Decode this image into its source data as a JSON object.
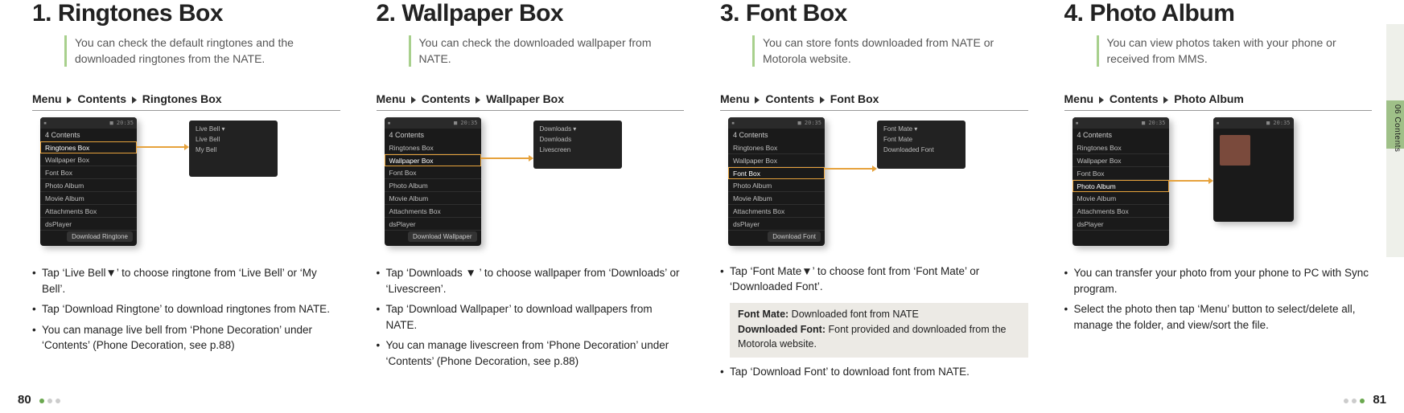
{
  "side_tab": "06 Contents",
  "page_left": "80",
  "page_right": "81",
  "sections": [
    {
      "title": "1. Ringtones Box",
      "intro": "You can check the default ringtones and the downloaded ringtones from the NATE.",
      "crumb": [
        "Menu",
        "Contents",
        "Ringtones Box"
      ],
      "phone": {
        "header": "4 Contents",
        "items": [
          "Ringtones Box",
          "Wallpaper Box",
          "Font Box",
          "Photo Album",
          "Movie Album",
          "Attachments Box",
          "dsPlayer"
        ],
        "highlight_index": 0,
        "footer_btn": "Download Ringtone",
        "sub_items": [
          "Live Bell ▾",
          "Live Bell",
          "My Bell"
        ]
      },
      "bullets": [
        "Tap ‘Live Bell▼’ to choose ringtone from ‘Live Bell’ or ‘My Bell’.",
        "Tap ‘Download Ringtone’ to download ringtones from NATE.",
        "You can manage live bell from ‘Phone Decoration’ under ‘Contents’ (Phone Decoration, see p.88)"
      ]
    },
    {
      "title": "2. Wallpaper Box",
      "intro": "You can check the downloaded wallpaper from NATE.",
      "crumb": [
        "Menu",
        "Contents",
        "Wallpaper Box"
      ],
      "phone": {
        "header": "4 Contents",
        "items": [
          "Ringtones Box",
          "Wallpaper Box",
          "Font Box",
          "Photo Album",
          "Movie Album",
          "Attachments Box",
          "dsPlayer"
        ],
        "highlight_index": 1,
        "footer_btn": "Download Wallpaper",
        "sub_items": [
          "Downloads ▾",
          "Downloads",
          "Livescreen"
        ]
      },
      "bullets": [
        "Tap ‘Downloads ▼ ’ to choose wallpaper from ‘Downloads’ or ‘Livescreen’.",
        "Tap ‘Download Wallpaper’ to download wallpapers from NATE.",
        "You can manage livescreen from ‘Phone Decoration’ under ‘Contents’ (Phone Decoration, see p.88)"
      ]
    },
    {
      "title": "3. Font Box",
      "intro": "You can store fonts downloaded from NATE or Motorola website.",
      "crumb": [
        "Menu",
        "Contents",
        "Font Box"
      ],
      "phone": {
        "header": "4 Contents",
        "items": [
          "Ringtones Box",
          "Wallpaper Box",
          "Font Box",
          "Photo Album",
          "Movie Album",
          "Attachments Box",
          "dsPlayer"
        ],
        "highlight_index": 2,
        "footer_btn": "Download Font",
        "sub_items": [
          "Font Mate ▾",
          "Font Mate",
          "Downloaded Font"
        ]
      },
      "bullets_before": [
        "Tap ‘Font Mate▼’ to choose font from ‘Font Mate’ or ‘Downloaded Font’."
      ],
      "infobox": [
        {
          "label": "Font Mate:",
          "text": " Downloaded font from NATE"
        },
        {
          "label": "Downloaded Font:",
          "text": " Font provided and downloaded from the Motorola website."
        }
      ],
      "bullets_after": [
        "Tap ‘Download Font’ to download font from NATE."
      ]
    },
    {
      "title": "4. Photo Album",
      "intro": "You can view photos taken with your phone or received from MMS.",
      "crumb": [
        "Menu",
        "Contents",
        "Photo Album"
      ],
      "phone": {
        "header": "4 Contents",
        "items": [
          "Ringtones Box",
          "Wallpaper Box",
          "Font Box",
          "Photo Album",
          "Movie Album",
          "Attachments Box",
          "dsPlayer"
        ],
        "highlight_index": 3,
        "footer_btn": "",
        "thumb_label": ""
      },
      "bullets": [
        "You can transfer your photo from your phone to PC with Sync program.",
        "Select the photo then tap ‘Menu’ button to select/delete all, manage the folder, and view/sort the file."
      ]
    }
  ]
}
